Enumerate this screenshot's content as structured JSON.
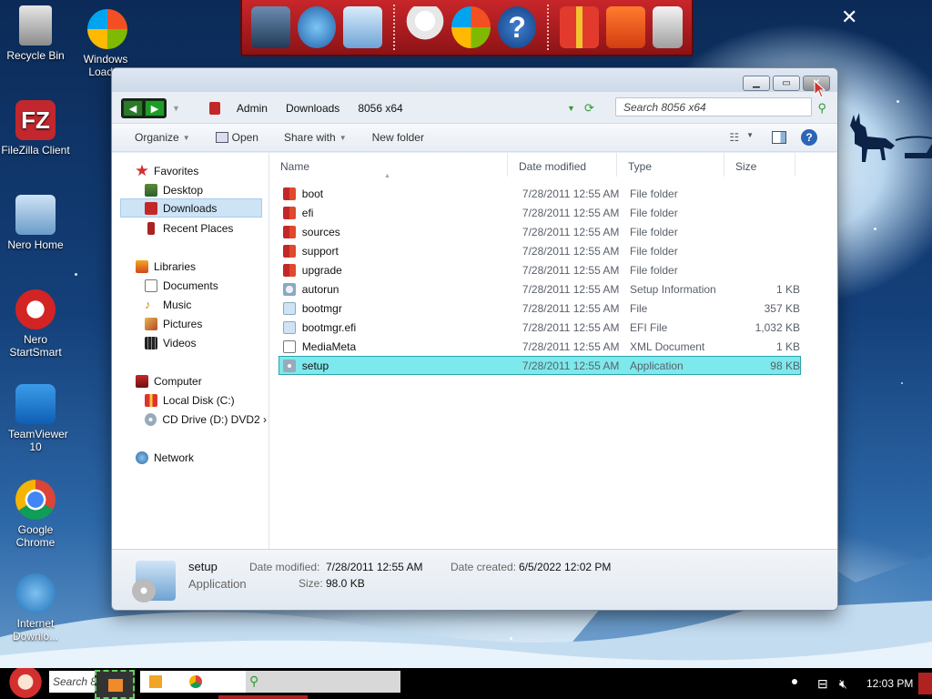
{
  "desktop": {
    "icons": [
      {
        "label": "Recycle Bin"
      },
      {
        "label": "Windows Loader"
      },
      {
        "label": "FileZilla Client"
      },
      {
        "label": "Nero Home"
      },
      {
        "label": "Nero StartSmart"
      },
      {
        "label": "TeamViewer 10"
      },
      {
        "label": "Google Chrome"
      },
      {
        "label": "Internet Downlo..."
      }
    ]
  },
  "window": {
    "breadcrumb": [
      "Admin",
      "Downloads",
      "8056 x64"
    ],
    "search_placeholder": "Search 8056 x64",
    "toolbar": {
      "organize": "Organize",
      "open": "Open",
      "share_with": "Share with",
      "new_folder": "New folder"
    },
    "nav": {
      "favorites": "Favorites",
      "desktop": "Desktop",
      "downloads": "Downloads",
      "recent": "Recent Places",
      "libraries": "Libraries",
      "documents": "Documents",
      "music": "Music",
      "pictures": "Pictures",
      "videos": "Videos",
      "computer": "Computer",
      "local_disk": "Local Disk (C:)",
      "cd_drive": "CD Drive (D:) DVD2 ›",
      "network": "Network"
    },
    "columns": {
      "name": "Name",
      "date": "Date modified",
      "type": "Type",
      "size": "Size"
    },
    "files": [
      {
        "name": "boot",
        "date": "7/28/2011 12:55 AM",
        "type": "File folder",
        "size": ""
      },
      {
        "name": "efi",
        "date": "7/28/2011 12:55 AM",
        "type": "File folder",
        "size": ""
      },
      {
        "name": "sources",
        "date": "7/28/2011 12:55 AM",
        "type": "File folder",
        "size": ""
      },
      {
        "name": "support",
        "date": "7/28/2011 12:55 AM",
        "type": "File folder",
        "size": ""
      },
      {
        "name": "upgrade",
        "date": "7/28/2011 12:55 AM",
        "type": "File folder",
        "size": ""
      },
      {
        "name": "autorun",
        "date": "7/28/2011 12:55 AM",
        "type": "Setup Information",
        "size": "1 KB"
      },
      {
        "name": "bootmgr",
        "date": "7/28/2011 12:55 AM",
        "type": "File",
        "size": "357 KB"
      },
      {
        "name": "bootmgr.efi",
        "date": "7/28/2011 12:55 AM",
        "type": "EFI File",
        "size": "1,032 KB"
      },
      {
        "name": "MediaMeta",
        "date": "7/28/2011 12:55 AM",
        "type": "XML Document",
        "size": "1 KB"
      },
      {
        "name": "setup",
        "date": "7/28/2011 12:55 AM",
        "type": "Application",
        "size": "98 KB"
      }
    ],
    "details": {
      "name": "setup",
      "kind": "Application",
      "date_modified_label": "Date modified:",
      "date_modified": "7/28/2011 12:55 AM",
      "date_created_label": "Date created:",
      "date_created": "6/5/2022 12:02 PM",
      "size_label": "Size:",
      "size": "98.0 KB"
    }
  },
  "taskbar": {
    "search": "Search 8",
    "clock": "12:03 PM"
  },
  "colors": {
    "selected_row": "#7ee9ec",
    "dock_red": "#c8262a"
  }
}
